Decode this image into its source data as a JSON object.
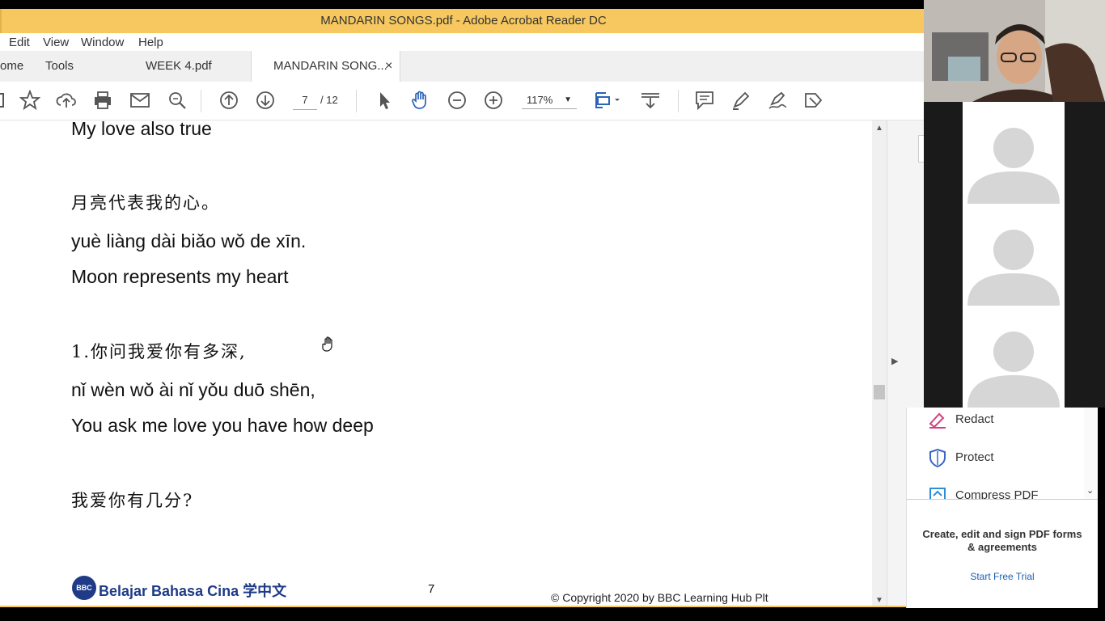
{
  "window": {
    "title": "MANDARIN SONGS.pdf - Adobe Acrobat Reader DC"
  },
  "menu": [
    "Edit",
    "View",
    "Window",
    "Help"
  ],
  "tabs": {
    "home": "ome",
    "tools": "Tools",
    "week4": "WEEK 4.pdf",
    "active": "MANDARIN SONG...",
    "close": "×"
  },
  "toolbar": {
    "icons": [
      "star-icon",
      "cloud-upload-icon",
      "print-icon",
      "mail-icon",
      "search-icon",
      "prev-page-icon",
      "next-page-icon",
      "select-icon",
      "hand-icon",
      "zoom-out-icon",
      "zoom-in-icon",
      "fit-page-icon",
      "scroll-mode-icon",
      "comment-icon",
      "highlight-icon",
      "sign-icon",
      "more-tools-icon"
    ],
    "page_current": "7",
    "page_total": "/ 12",
    "zoom": "117%"
  },
  "document": {
    "lines": [
      "My love also true",
      "月亮代表我的心。",
      "yuè liàng dài biǎo wǒ de xīn.",
      "Moon represents my heart",
      "1.你问我爱你有多深,",
      "nǐ wèn wǒ ài nǐ yǒu duō shēn,",
      "You ask me love you have how deep",
      "我爱你有几分?"
    ],
    "footer": {
      "logo_badge": "BBC",
      "logo_text": "Belajar Bahasa Cina 学中文",
      "page_number": "7",
      "copyright": "© Copyright 2020 by BBC Learning Hub Plt"
    }
  },
  "tools_panel": {
    "items": [
      "Redact",
      "Protect",
      "Compress PDF"
    ]
  },
  "promo": {
    "headline": "Create, edit and sign PDF forms & agreements",
    "link": "Start Free Trial"
  },
  "colors": {
    "title_bar": "#f6c85f",
    "accent_blue": "#2b63b8",
    "link_blue": "#1a5fb4"
  }
}
